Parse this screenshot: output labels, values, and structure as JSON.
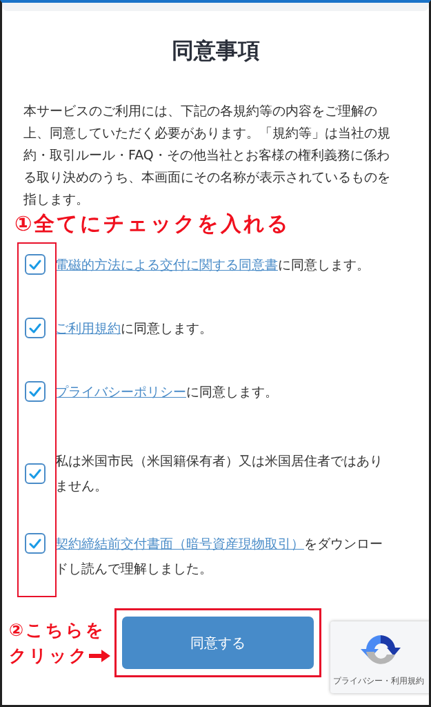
{
  "title": "同意事項",
  "intro": "本サービスのご利用には、下記の各規約等の内容をご理解の上、同意していただく必要があります。「規約等」は当社の規約・取引ルール・FAQ・その他当社とお客様の権利義務に係わる取り決めのうち、本画面にその名称が表示されているものを指します。",
  "step1_note": "①全てにチェックを入れる",
  "agreements": [
    {
      "link": "電磁的方法による交付に関する同意書",
      "text": "に同意します。",
      "checked": true
    },
    {
      "link": "ご利用規約",
      "text": "に同意します。",
      "checked": true
    },
    {
      "link": "プライバシーポリシー",
      "text": "に同意します。",
      "checked": true
    },
    {
      "text": "私は米国市民（米国籍保有者）又は米国居住者ではありません。",
      "checked": true
    },
    {
      "link": "契約締結前交付書面（暗号資産現物取引）",
      "text": "をダウンロードし読んで理解しました。",
      "checked": true
    }
  ],
  "step2_note": [
    "②こちらを",
    "クリック"
  ],
  "agree_button": "同意する",
  "recaptcha": {
    "footer": "プライバシー・利用規約"
  }
}
